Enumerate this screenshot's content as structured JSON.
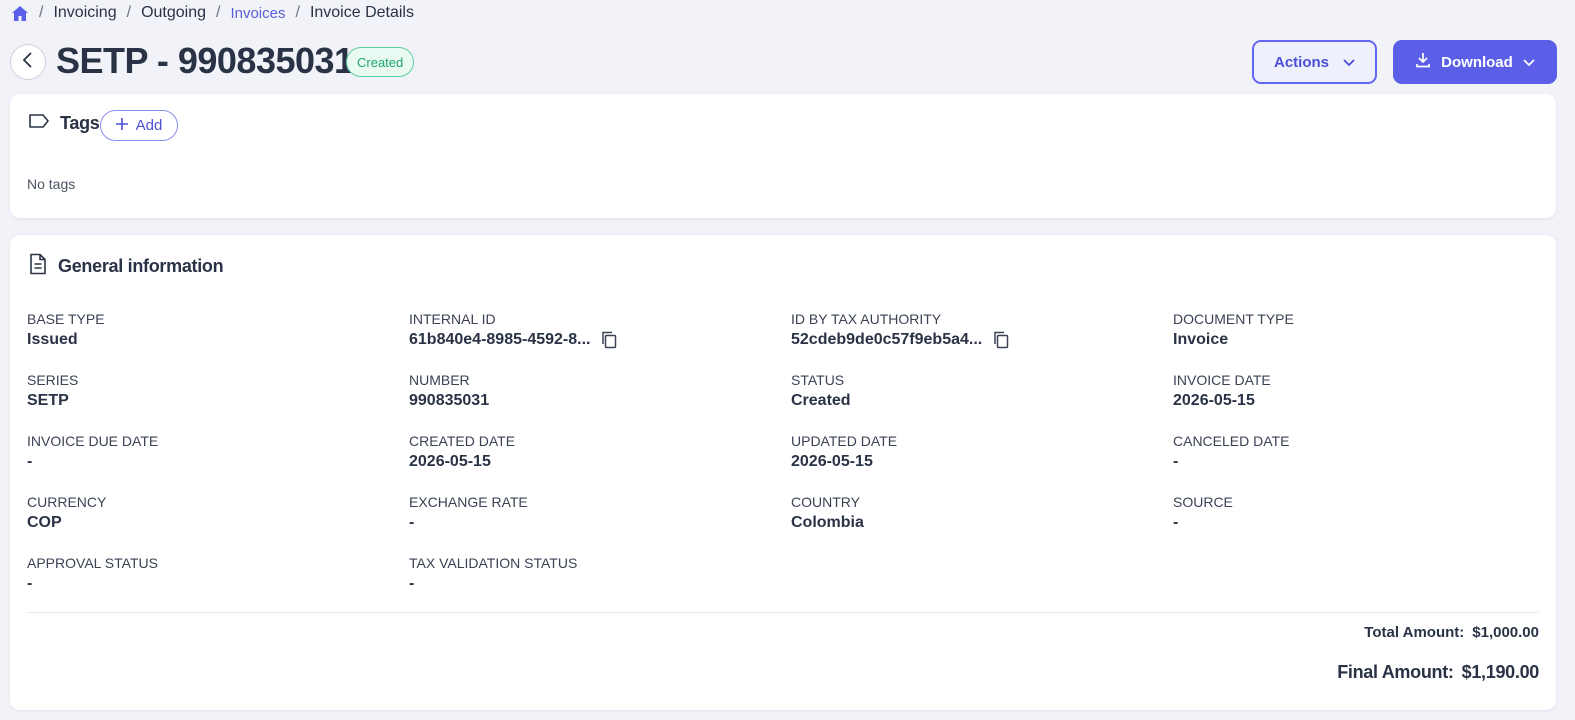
{
  "breadcrumb": {
    "items": [
      "Invoicing",
      "Outgoing",
      "Invoices",
      "Invoice Details"
    ],
    "separator": "/"
  },
  "header": {
    "title": "SETP - 990835031",
    "status_badge": "Created",
    "actions_label": "Actions",
    "download_label": "Download"
  },
  "tags": {
    "title": "Tags",
    "add_label": "Add",
    "empty_text": "No tags"
  },
  "general": {
    "title": "General information",
    "fields": [
      {
        "label": "BASE TYPE",
        "value": "Issued"
      },
      {
        "label": "INTERNAL ID",
        "value": "61b840e4-8985-4592-8..."
      },
      {
        "label": "ID BY TAX AUTHORITY",
        "value": "52cdeb9de0c57f9eb5a4..."
      },
      {
        "label": "DOCUMENT TYPE",
        "value": "Invoice"
      },
      {
        "label": "SERIES",
        "value": "SETP"
      },
      {
        "label": "NUMBER",
        "value": "990835031"
      },
      {
        "label": "STATUS",
        "value": "Created"
      },
      {
        "label": "INVOICE DATE",
        "value": "2026-05-15"
      },
      {
        "label": "INVOICE DUE DATE",
        "value": "-"
      },
      {
        "label": "CREATED DATE",
        "value": "2026-05-15"
      },
      {
        "label": "UPDATED DATE",
        "value": "2026-05-15"
      },
      {
        "label": "CANCELED DATE",
        "value": "-"
      },
      {
        "label": "CURRENCY",
        "value": "COP"
      },
      {
        "label": "EXCHANGE RATE",
        "value": "-"
      },
      {
        "label": "COUNTRY",
        "value": "Colombia"
      },
      {
        "label": "SOURCE",
        "value": "-"
      },
      {
        "label": "APPROVAL STATUS",
        "value": "-"
      },
      {
        "label": "TAX VALIDATION STATUS",
        "value": "-"
      }
    ],
    "total_label": "Total Amount:",
    "total_value": "$1,000.00",
    "final_label": "Final Amount:",
    "final_value": "$1,190.00"
  },
  "icons": {
    "home": "home-icon",
    "back": "chevron-left-icon",
    "chevron": "chevron-down-icon",
    "download": "download-icon",
    "tag": "tag-icon",
    "plus": "plus-icon",
    "document": "document-icon",
    "copy": "copy-icon"
  },
  "colors": {
    "accent": "#5b5fe8",
    "status_green": "#20a36e",
    "background": "#f1f3f9"
  }
}
